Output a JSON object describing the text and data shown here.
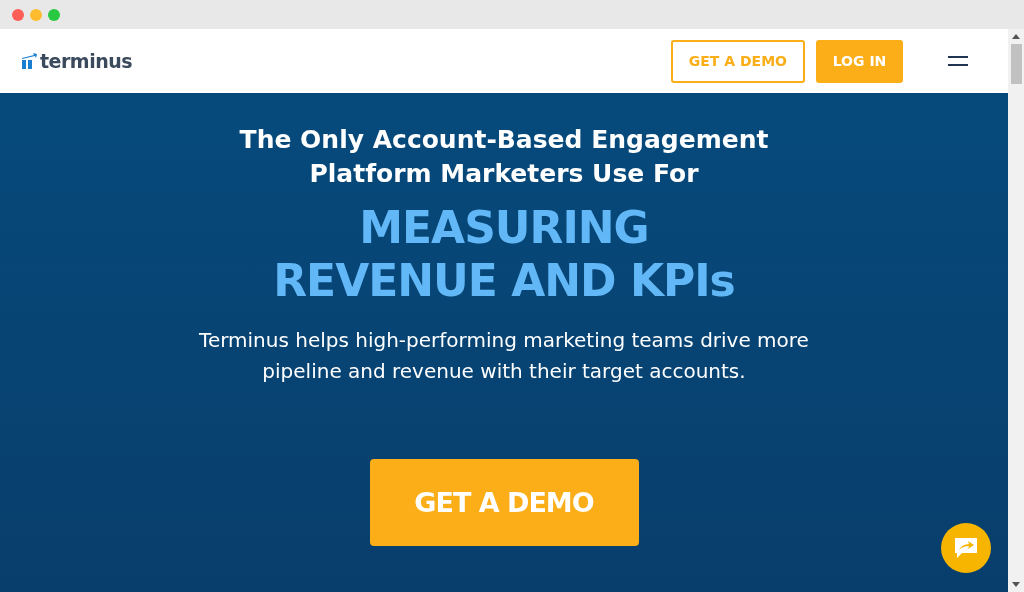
{
  "header": {
    "logo": "terminus",
    "buttons": [
      {
        "label": "GET A DEMO",
        "kind": "outline"
      },
      {
        "label": "LOG IN",
        "kind": "filled"
      }
    ]
  },
  "hero": {
    "heading": "The Only Account-Based Engagement Platform Marketers Use For",
    "highlight": "MEASURING REVENUE AND KPIs",
    "description": "Terminus helps high-performing marketing teams drive more pipeline and revenue with their target accounts.",
    "cta": "GET A DEMO"
  }
}
